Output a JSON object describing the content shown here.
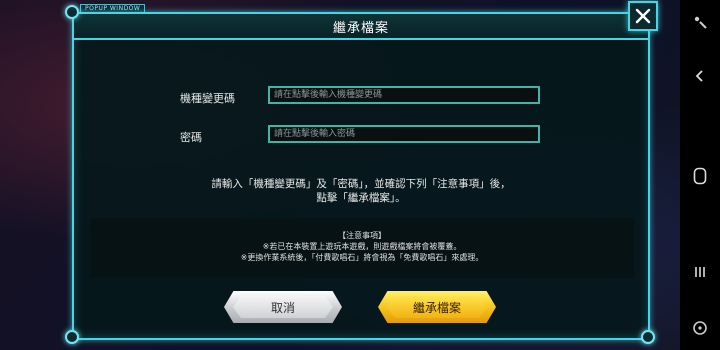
{
  "popup": {
    "tag": "POPUP WINDOW",
    "title": "繼承檔案"
  },
  "form": {
    "device_code_label": "機種變更碼",
    "device_code_placeholder": "請在點擊後輸入機種變更碼",
    "password_label": "密碼",
    "password_placeholder": "請在點擊後輸入密碼"
  },
  "instruction": {
    "line1": "請輸入「機種變更碼」及「密碼」，並確認下列「注意事項」後，",
    "line2": "點擊「繼承檔案」。"
  },
  "notice": {
    "heading": "【注意事項】",
    "line1": "※若已在本裝置上遊玩本遊戲，則遊戲檔案將會被覆蓋。",
    "line2": "※更換作業系統後，「付費歌唱石」將會視為「免費歌唱石」來處理。"
  },
  "buttons": {
    "cancel": "取消",
    "confirm": "繼承檔案"
  },
  "icons": {
    "close": "close-icon",
    "nav_top": "menu-icon",
    "back": "back-icon",
    "home": "home-icon",
    "recents": "recents-icon",
    "bottom": "gamepad-icon"
  },
  "colors": {
    "accent": "#45d6e6",
    "confirm": "#f4c218",
    "cancel": "#c9cccf"
  }
}
